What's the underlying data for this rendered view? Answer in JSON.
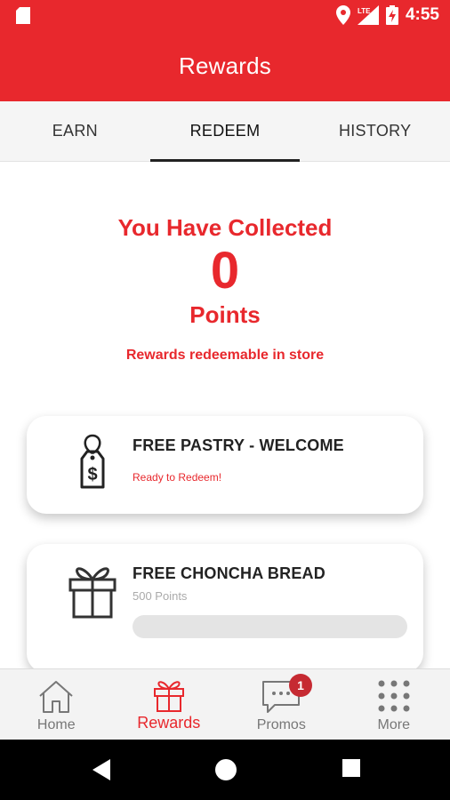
{
  "status_bar": {
    "time": "4:55",
    "network": "LTE",
    "icons": [
      "sd-card-icon",
      "location-pin-icon",
      "signal-icon",
      "battery-charging-icon"
    ]
  },
  "app_bar": {
    "title": "Rewards"
  },
  "tabs": [
    {
      "label": "EARN",
      "active": false
    },
    {
      "label": "REDEEM",
      "active": true
    },
    {
      "label": "HISTORY",
      "active": false
    }
  ],
  "points": {
    "heading": "You Have Collected",
    "count": "0",
    "unit": "Points",
    "note": "Rewards redeemable in store"
  },
  "rewards": [
    {
      "title": "FREE PASTRY - WELCOME",
      "status": "Ready to Redeem!",
      "icon": "price-tag-icon"
    },
    {
      "title": "FREE CHONCHA BREAD",
      "points_required": "500 Points",
      "progress": 0,
      "icon": "gift-icon"
    }
  ],
  "bottom_nav": [
    {
      "label": "Home",
      "icon": "home-icon",
      "active": false
    },
    {
      "label": "Rewards",
      "icon": "gift-icon",
      "active": true
    },
    {
      "label": "Promos",
      "icon": "chat-bubble-icon",
      "active": false,
      "badge": "1"
    },
    {
      "label": "More",
      "icon": "grid-dots-icon",
      "active": false
    }
  ],
  "system_nav": [
    "back-icon",
    "home-circle-icon",
    "recents-icon"
  ],
  "colors": {
    "brand": "#e8282d",
    "badge": "#c62a32",
    "inactive": "#777777"
  }
}
